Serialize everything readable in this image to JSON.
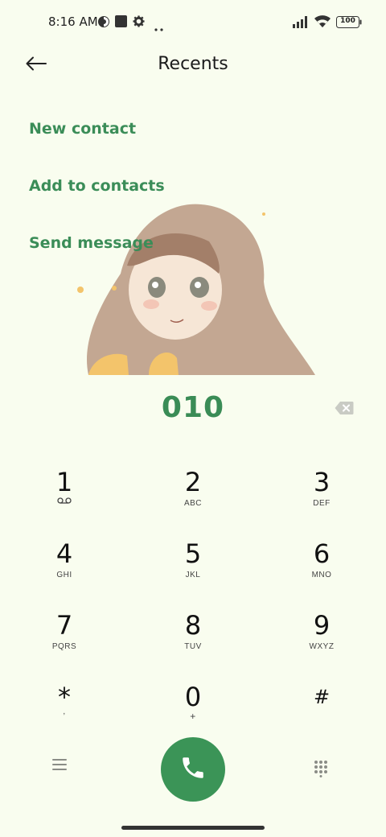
{
  "status_bar": {
    "time": "8:16 AM",
    "battery": "100",
    "icons": [
      "vpn-icon",
      "square-app-icon",
      "gear-icon",
      "more-dots-icon",
      "signal-icon",
      "wifi-icon",
      "battery-icon"
    ]
  },
  "header": {
    "title": "Recents",
    "back_icon": "back-arrow-icon"
  },
  "actions": {
    "new_contact": "New contact",
    "add_to_contacts": "Add to contacts",
    "send_message": "Send message"
  },
  "dialer": {
    "number": "010",
    "backspace_icon": "backspace-icon"
  },
  "keypad": {
    "keys": [
      {
        "digit": "1",
        "letters": ""
      },
      {
        "digit": "2",
        "letters": "ABC"
      },
      {
        "digit": "3",
        "letters": "DEF"
      },
      {
        "digit": "4",
        "letters": "GHI"
      },
      {
        "digit": "5",
        "letters": "JKL"
      },
      {
        "digit": "6",
        "letters": "MNO"
      },
      {
        "digit": "7",
        "letters": "PQRS"
      },
      {
        "digit": "8",
        "letters": "TUV"
      },
      {
        "digit": "9",
        "letters": "WXYZ"
      },
      {
        "digit": "*",
        "letters": ","
      },
      {
        "digit": "0",
        "letters": "+"
      },
      {
        "digit": "#",
        "letters": ""
      }
    ]
  },
  "bottom_bar": {
    "menu_icon": "menu-icon",
    "call_icon": "phone-icon",
    "dialpad_icon": "dialpad-icon"
  },
  "colors": {
    "accent": "#3b8d58",
    "background": "#f9fdef",
    "call_button": "#3b9457"
  }
}
